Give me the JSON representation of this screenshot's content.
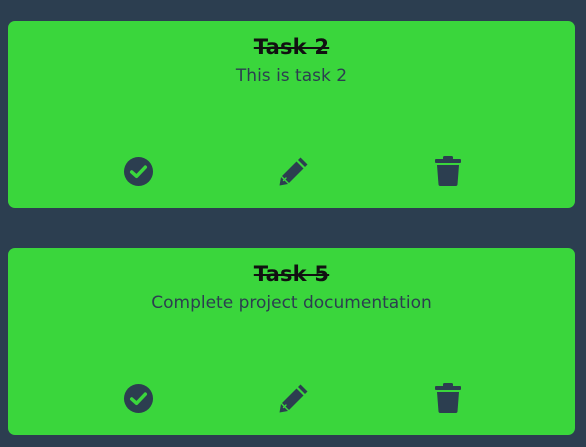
{
  "tasks": [
    {
      "title": "Task 2",
      "description": "This is task 2",
      "completed": true,
      "actions": [
        "check-circle-icon",
        "pencil-icon",
        "trash-icon"
      ]
    },
    {
      "title": "Task 5",
      "description": "Complete project documentation",
      "completed": true,
      "actions": [
        "check-circle-icon",
        "pencil-icon",
        "trash-icon"
      ]
    }
  ],
  "colors": {
    "background": "#2c3e50",
    "card": "#3ad63c",
    "icon": "#2c3e50",
    "title": "#111111"
  }
}
